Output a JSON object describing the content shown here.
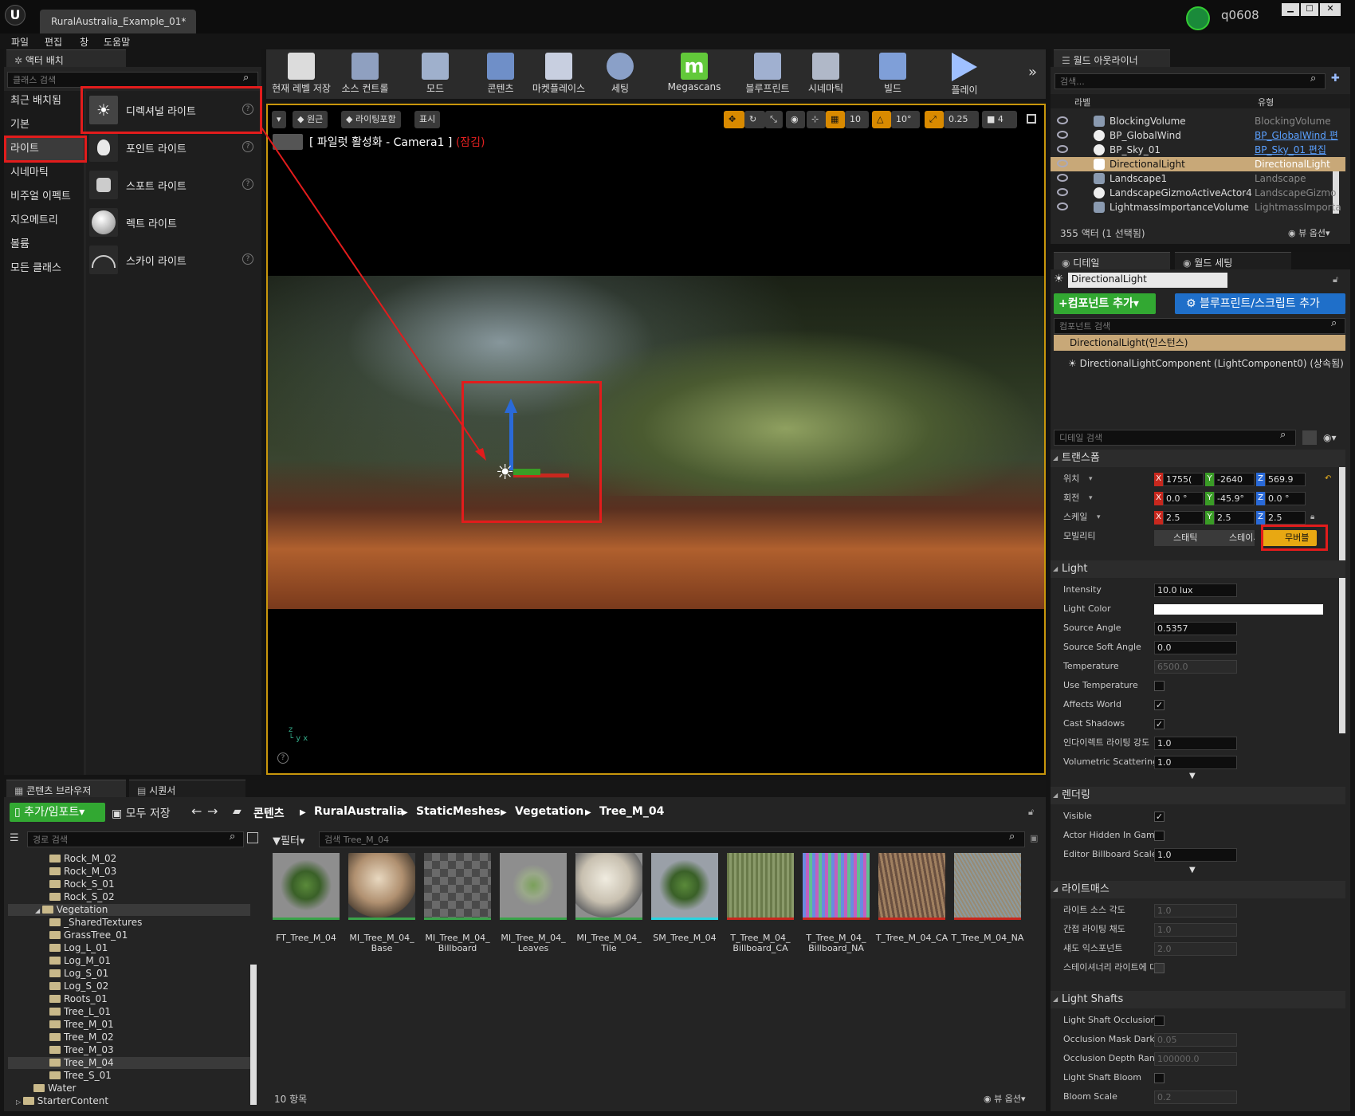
{
  "window": {
    "tab_title": "RuralAustralia_Example_01*",
    "user": "q0608"
  },
  "menu": [
    "파일",
    "편집",
    "창",
    "도움말"
  ],
  "place_actors": {
    "tab": "액터 배치",
    "search_placeholder": "클래스 검색",
    "categories": [
      "최근 배치됨",
      "기본",
      "라이트",
      "시네마틱",
      "비주얼 이펙트",
      "지오메트리",
      "볼륨",
      "모든 클래스"
    ],
    "items": [
      "디렉셔널 라이트",
      "포인트 라이트",
      "스포트 라이트",
      "렉트 라이트",
      "스카이 라이트"
    ]
  },
  "toolbar": [
    "현재 레벨 저장",
    "소스 컨트롤",
    "모드",
    "콘텐츠",
    "마켓플레이스",
    "세팅",
    "Megascans",
    "블루프린트",
    "시네마틱",
    "빌드",
    "플레이"
  ],
  "viewport": {
    "btn_perspective": "원근",
    "btn_lit": "라이팅포함",
    "btn_show": "표시",
    "title": "[ 파일럿 활성화 - Camera1 ]",
    "locked": "(잠김)",
    "grid": "10",
    "angle": "10°",
    "scale": "0.25",
    "cam": "4"
  },
  "outliner": {
    "tab": "월드 아웃라이너",
    "search_placeholder": "검색...",
    "col_label": "라벨",
    "col_type": "유형",
    "rows": [
      {
        "label": "BlockingVolume",
        "type": "BlockingVolume"
      },
      {
        "label": "BP_GlobalWind",
        "type": "BP_GlobalWind 편"
      },
      {
        "label": "BP_Sky_01",
        "type": "BP_Sky_01 편집"
      },
      {
        "label": "DirectionalLight",
        "type": "DirectionalLight"
      },
      {
        "label": "Landscape1",
        "type": "Landscape"
      },
      {
        "label": "LandscapeGizmoActiveActor4",
        "type": "LandscapeGizmo"
      },
      {
        "label": "LightmassImportanceVolume",
        "type": "LightmassImporta"
      }
    ],
    "count": "355 액터 (1 선택됨)",
    "view_options": "뷰 옵션"
  },
  "details": {
    "tab": "디테일",
    "tab2": "월드 세팅",
    "actor_name": "DirectionalLight",
    "add_component": "+컴포넌트 추가",
    "add_script": "블루프린트/스크립트 추가",
    "component_search": "컴포넌트 검색",
    "instance": "DirectionalLight(인스턴스)",
    "component": "DirectionalLightComponent (LightComponent0) (상속됨)",
    "detail_search": "디테일 검색",
    "transform": {
      "section": "트랜스폼",
      "location_label": "위치",
      "rotation_label": "회전",
      "scale_label": "스케일",
      "mobility_label": "모빌리티",
      "location": [
        "1755(",
        "-2640",
        "569.9"
      ],
      "rotation": [
        "0.0 °",
        "-45.9°",
        "0.0 °"
      ],
      "scale": [
        "2.5",
        "2.5",
        "2.5"
      ],
      "mobility": [
        "스태틱",
        "스테이셔",
        "무버블"
      ]
    },
    "light": {
      "section": "Light",
      "intensity_label": "Intensity",
      "intensity": "10.0 lux",
      "color_label": "Light Color",
      "source_angle_label": "Source Angle",
      "source_angle": "0.5357",
      "soft_angle_label": "Source Soft Angle",
      "soft_angle": "0.0",
      "temperature_label": "Temperature",
      "temperature": "6500.0",
      "use_temp_label": "Use Temperature",
      "affects_world_label": "Affects World",
      "cast_shadows_label": "Cast Shadows",
      "indirect_label": "인다이렉트 라이팅 강도",
      "indirect": "1.0",
      "volumetric_label": "Volumetric Scattering",
      "volumetric": "1.0"
    },
    "rendering": {
      "section": "렌더링",
      "visible_label": "Visible",
      "hidden_label": "Actor Hidden In Game",
      "billboard_label": "Editor Billboard Scale",
      "billboard": "1.0"
    },
    "lightmass": {
      "section": "라이트매스",
      "source_angle_label": "라이트 소스 각도",
      "source_angle": "1.0",
      "indirect_sat_label": "간접 라이팅 채도",
      "indirect_sat": "1.0",
      "shadow_exp_label": "섀도 익스포넌트",
      "shadow_exp": "2.0",
      "stationary_label": "스테이셔너리 라이트에 대"
    },
    "shafts": {
      "section": "Light Shafts",
      "occlusion_label": "Light Shaft Occlusion",
      "mask_label": "Occlusion Mask Darkness",
      "mask": "0.05",
      "depth_label": "Occlusion Depth Range",
      "depth": "100000.0",
      "bloom_label": "Light Shaft Bloom",
      "bloom_scale_label": "Bloom Scale",
      "bloom_scale": "0.2"
    }
  },
  "content_browser": {
    "tab": "콘텐츠 브라우저",
    "tab2": "시퀀서",
    "add_import": "추가/임포트",
    "save_all": "모두 저장",
    "breadcrumb": [
      "콘텐츠",
      "RuralAustralia",
      "StaticMeshes",
      "Vegetation",
      "Tree_M_04"
    ],
    "path_search": "경로 검색",
    "filter": "필터",
    "asset_search": "검색 Tree_M_04",
    "tree": [
      "Rock_M_02",
      "Rock_M_03",
      "Rock_S_01",
      "Rock_S_02",
      "Vegetation",
      "_SharedTextures",
      "GrassTree_01",
      "Log_L_01",
      "Log_M_01",
      "Log_S_01",
      "Log_S_02",
      "Roots_01",
      "Tree_L_01",
      "Tree_M_01",
      "Tree_M_02",
      "Tree_M_03",
      "Tree_M_04",
      "Tree_S_01",
      "Water",
      "StarterContent"
    ],
    "assets": [
      "FT_Tree_M_04",
      "MI_Tree_M_04_ Base",
      "MI_Tree_M_04_ Billboard",
      "MI_Tree_M_04_ Leaves",
      "MI_Tree_M_04_ Tile",
      "SM_Tree_M_04",
      "T_Tree_M_04_ Billboard_CA",
      "T_Tree_M_04_ Billboard_NA",
      "T_Tree_M_04_CA",
      "T_Tree_M_04_NA"
    ],
    "count": "10 항목",
    "view_options": "뷰 옵션"
  }
}
